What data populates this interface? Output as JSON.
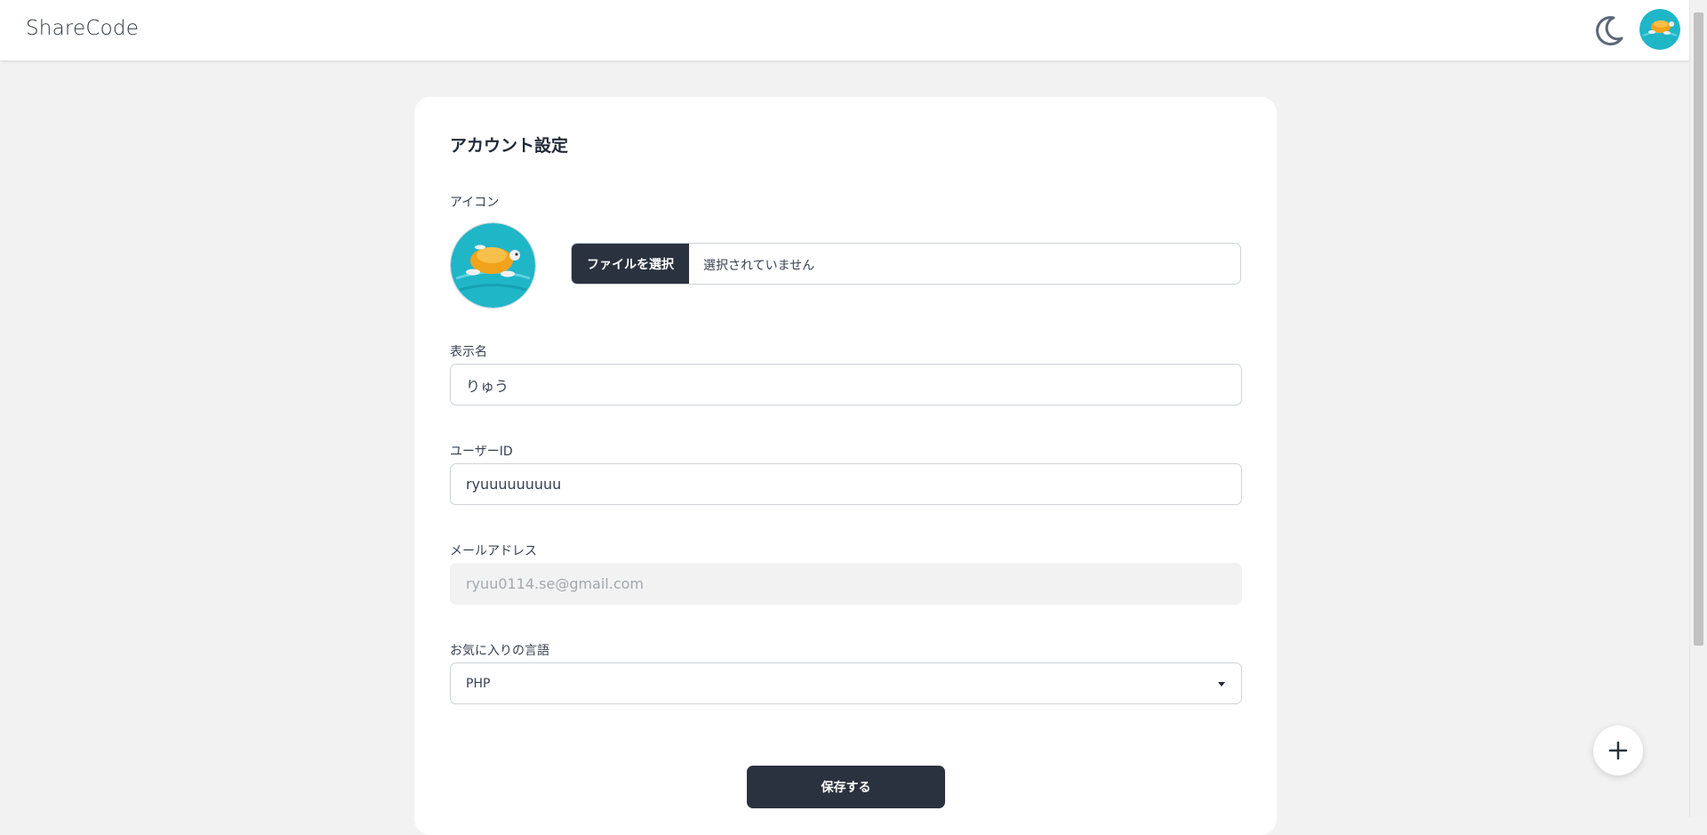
{
  "header": {
    "brand": "ShareCode",
    "theme_icon": "moon-icon",
    "avatar_icon": "turtle-avatar"
  },
  "form": {
    "title": "アカウント設定",
    "icon_label": "アイコン",
    "file_button": "ファイルを選択",
    "file_status": "選択されていません",
    "display_name_label": "表示名",
    "display_name_value": "りゅう",
    "user_id_label": "ユーザーID",
    "user_id_value": "ryuuuuuuuuu",
    "email_label": "メールアドレス",
    "email_value": "ryuu0114.se@gmail.com",
    "language_label": "お気に入りの言語",
    "language_value": "PHP",
    "save_button": "保存する"
  },
  "fab": {
    "icon": "plus-icon"
  },
  "colors": {
    "primary_dark": "#2a323f",
    "background": "#f2f2f2",
    "card": "#ffffff",
    "avatar_water": "#1fb6c8",
    "turtle_shell": "#f2a31b"
  }
}
